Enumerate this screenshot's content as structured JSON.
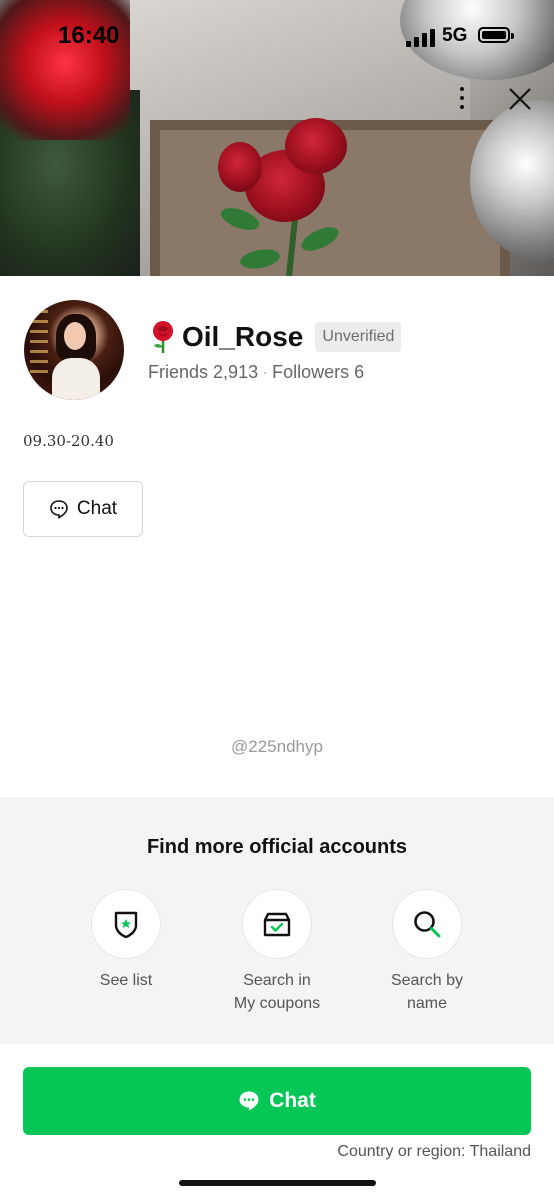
{
  "status_bar": {
    "time": "16:40",
    "network": "5G"
  },
  "profile": {
    "name": "Oil_Rose",
    "badge": "Unverified",
    "friends_label": "Friends",
    "friends_count": "2,913",
    "followers_label": "Followers",
    "followers_count": "6",
    "status_message": "09.30-20.40",
    "chat_label": "Chat",
    "handle": "@225ndhyp"
  },
  "find_more": {
    "title": "Find more official accounts",
    "options": [
      {
        "label_line1": "See list",
        "label_line2": "",
        "icon": "shield-star-icon"
      },
      {
        "label_line1": "Search in",
        "label_line2": "My coupons",
        "icon": "coupon-box-icon"
      },
      {
        "label_line1": "Search by",
        "label_line2": "name",
        "icon": "search-icon"
      }
    ]
  },
  "footer": {
    "chat_label": "Chat",
    "country": "Country or region: Thailand"
  },
  "colors": {
    "accent": "#06c755",
    "find_bg": "#f4f4f4"
  }
}
